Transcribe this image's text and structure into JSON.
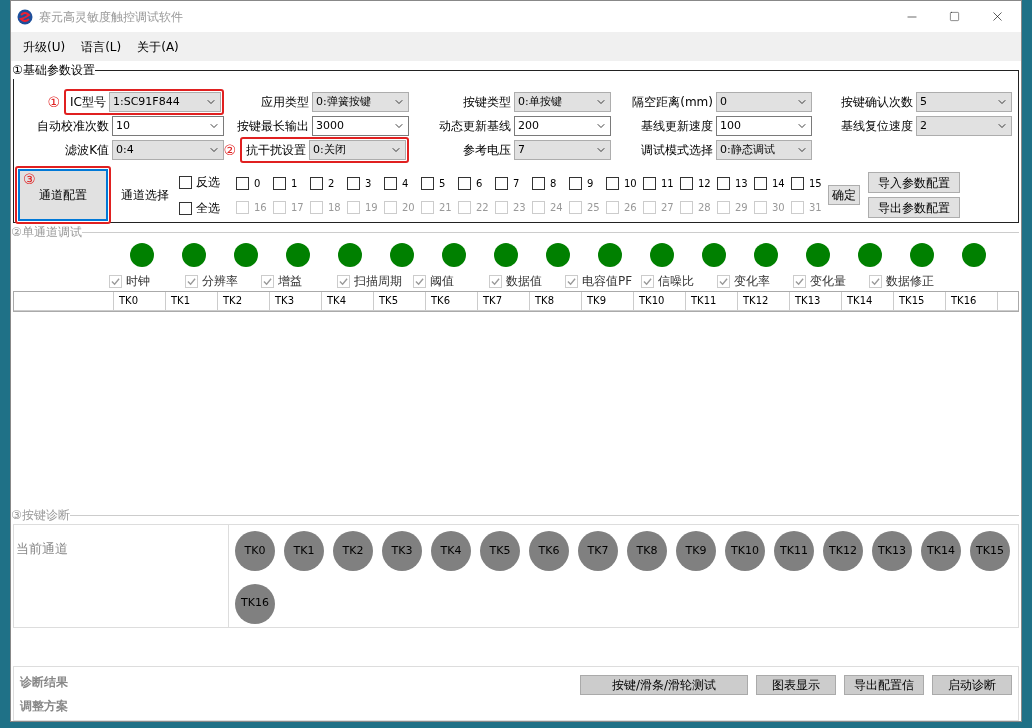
{
  "window": {
    "title": "赛元高灵敏度触控调试软件"
  },
  "menu": [
    "升级(U)",
    "语言(L)",
    "关于(A)"
  ],
  "basic": {
    "title": "①基础参数设置",
    "rows": [
      [
        {
          "label": "IC型号",
          "value": "1:SC91F844",
          "editable": false,
          "annotation": "①"
        },
        {
          "label": "应用类型",
          "value": "0:弹簧按键",
          "editable": false
        },
        {
          "label": "按键类型",
          "value": "0:单按键",
          "editable": false
        },
        {
          "label": "隔空距离(mm)",
          "value": "0",
          "editable": false
        },
        {
          "label": "按键确认次数",
          "value": "5",
          "editable": false
        }
      ],
      [
        {
          "label": "自动校准次数",
          "value": "10",
          "editable": true
        },
        {
          "label": "按键最长输出",
          "value": "3000",
          "editable": true
        },
        {
          "label": "动态更新基线",
          "value": "200",
          "editable": true
        },
        {
          "label": "基线更新速度",
          "value": "100",
          "editable": true
        },
        {
          "label": "基线复位速度",
          "value": "2",
          "editable": false
        }
      ],
      [
        {
          "label": "滤波K值",
          "value": "0:4",
          "editable": false
        },
        {
          "label": "抗干扰设置",
          "value": "0:关闭",
          "editable": false,
          "annotation": "②"
        },
        {
          "label": "参考电压",
          "value": "7",
          "editable": false
        },
        {
          "label": "调试模式选择",
          "value": "0:静态调试",
          "editable": false
        }
      ]
    ],
    "channel_config_button": {
      "label": "通道配置",
      "annotation": "③",
      "focused": true
    },
    "channel_select_label": "通道选择",
    "invert": {
      "label": "反选",
      "checked": false
    },
    "select_all": {
      "label": "全选",
      "checked": false
    },
    "channels": [
      {
        "label": "0",
        "checked": false,
        "disabled": false
      },
      {
        "label": "1",
        "checked": false,
        "disabled": false
      },
      {
        "label": "2",
        "checked": false,
        "disabled": false
      },
      {
        "label": "3",
        "checked": false,
        "disabled": false
      },
      {
        "label": "4",
        "checked": false,
        "disabled": false
      },
      {
        "label": "5",
        "checked": false,
        "disabled": false
      },
      {
        "label": "6",
        "checked": false,
        "disabled": false
      },
      {
        "label": "7",
        "checked": false,
        "disabled": false
      },
      {
        "label": "8",
        "checked": false,
        "disabled": false
      },
      {
        "label": "9",
        "checked": false,
        "disabled": false
      },
      {
        "label": "10",
        "checked": false,
        "disabled": false
      },
      {
        "label": "11",
        "checked": false,
        "disabled": false
      },
      {
        "label": "12",
        "checked": false,
        "disabled": false
      },
      {
        "label": "13",
        "checked": false,
        "disabled": false
      },
      {
        "label": "14",
        "checked": false,
        "disabled": false
      },
      {
        "label": "15",
        "checked": false,
        "disabled": false
      },
      {
        "label": "16",
        "checked": false,
        "disabled": true
      },
      {
        "label": "17",
        "checked": false,
        "disabled": true
      },
      {
        "label": "18",
        "checked": false,
        "disabled": true
      },
      {
        "label": "19",
        "checked": false,
        "disabled": true
      },
      {
        "label": "20",
        "checked": false,
        "disabled": true
      },
      {
        "label": "21",
        "checked": false,
        "disabled": true
      },
      {
        "label": "22",
        "checked": false,
        "disabled": true
      },
      {
        "label": "23",
        "checked": false,
        "disabled": true
      },
      {
        "label": "24",
        "checked": false,
        "disabled": true
      },
      {
        "label": "25",
        "checked": false,
        "disabled": true
      },
      {
        "label": "26",
        "checked": false,
        "disabled": true
      },
      {
        "label": "27",
        "checked": false,
        "disabled": true
      },
      {
        "label": "28",
        "checked": false,
        "disabled": true
      },
      {
        "label": "29",
        "checked": false,
        "disabled": true
      },
      {
        "label": "30",
        "checked": false,
        "disabled": true
      },
      {
        "label": "31",
        "checked": false,
        "disabled": true
      }
    ],
    "confirm_button": "确定",
    "import_button": "导入参数配置",
    "export_button": "导出参数配置"
  },
  "single": {
    "title": "②单通道调试",
    "leds": [
      {
        "on": true
      },
      {
        "on": true
      },
      {
        "on": true
      },
      {
        "on": true
      },
      {
        "on": true
      },
      {
        "on": true
      },
      {
        "on": true
      },
      {
        "on": true
      },
      {
        "on": true
      },
      {
        "on": true
      },
      {
        "on": true
      },
      {
        "on": true
      },
      {
        "on": true
      },
      {
        "on": true
      },
      {
        "on": true
      },
      {
        "on": true
      },
      {
        "on": true
      }
    ],
    "options": [
      {
        "label": "时钟",
        "checked": true
      },
      {
        "label": "分辨率",
        "checked": true
      },
      {
        "label": "增益",
        "checked": true
      },
      {
        "label": "扫描周期",
        "checked": true
      },
      {
        "label": "阈值",
        "checked": true
      },
      {
        "label": "数据值",
        "checked": true
      },
      {
        "label": "电容值PF",
        "checked": true
      },
      {
        "label": "信噪比",
        "checked": true
      },
      {
        "label": "变化率",
        "checked": true
      },
      {
        "label": "变化量",
        "checked": true
      },
      {
        "label": "数据修正",
        "checked": true
      }
    ],
    "table": {
      "columns": [
        "TK0",
        "TK1",
        "TK2",
        "TK3",
        "TK4",
        "TK5",
        "TK6",
        "TK7",
        "TK8",
        "TK9",
        "TK10",
        "TK11",
        "TK12",
        "TK13",
        "TK14",
        "TK15",
        "TK16"
      ]
    }
  },
  "diagnosis": {
    "title": "③按键诊断",
    "current_channel_label": "当前通道",
    "keys": [
      "TK0",
      "TK1",
      "TK2",
      "TK3",
      "TK4",
      "TK5",
      "TK6",
      "TK7",
      "TK8",
      "TK9",
      "TK10",
      "TK11",
      "TK12",
      "TK13",
      "TK14",
      "TK15",
      "TK16"
    ],
    "result_label": "诊断结果",
    "plan_label": "调整方案",
    "buttons": [
      "按键/滑条/滑轮测试",
      "图表显示",
      "导出配置信",
      "启动诊断"
    ]
  }
}
